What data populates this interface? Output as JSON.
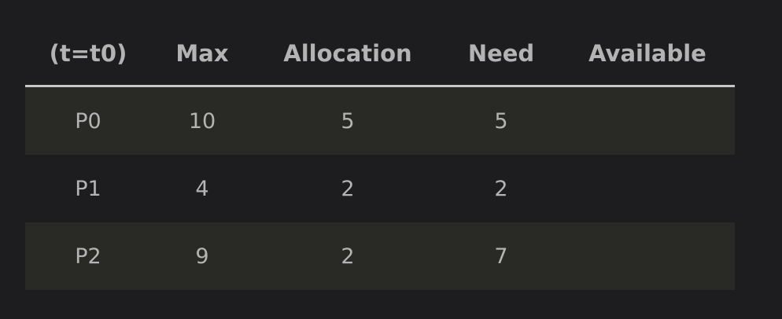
{
  "table": {
    "headers": [
      "(t=t0)",
      "Max",
      "Allocation",
      "Need",
      "Available"
    ],
    "rows": [
      [
        "P0",
        "10",
        "5",
        "5",
        ""
      ],
      [
        "P1",
        "4",
        "2",
        "2",
        ""
      ],
      [
        "P2",
        "9",
        "2",
        "7",
        ""
      ]
    ]
  },
  "colors": {
    "background": "#1d1d1f",
    "stripe": "#292a26",
    "header_rule": "#c7c7c7",
    "text": "#b4b4b4"
  }
}
